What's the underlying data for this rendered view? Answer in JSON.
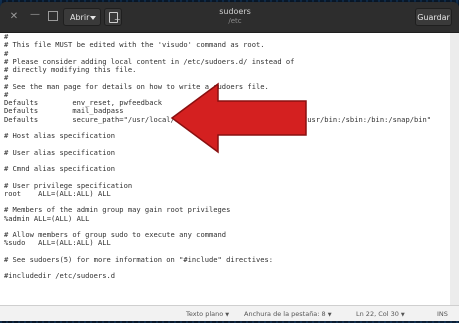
{
  "window": {
    "title": "sudoers",
    "subtitle": "/etc",
    "open_label": "Abrir",
    "save_label": "Guardar"
  },
  "editor": {
    "lines": [
      "#",
      "# This file MUST be edited with the 'visudo' command as root.",
      "#",
      "# Please consider adding local content in /etc/sudoers.d/ instead of",
      "# directly modifying this file.",
      "#",
      "# See the man page for details on how to write a sudoers file.",
      "#",
      "Defaults        env_reset, pwfeedback",
      "Defaults        mail_badpass",
      "Defaults        secure_path=\"/usr/local/sbin:/usr/local/bin:/usr/sbin:/usr/bin:/sbin:/bin:/snap/bin\"",
      "",
      "# Host alias specification",
      "",
      "# User alias specification",
      "",
      "# Cmnd alias specification",
      "",
      "# User privilege specification",
      "root    ALL=(ALL:ALL) ALL",
      "",
      "# Members of the admin group may gain root privileges",
      "%admin ALL=(ALL) ALL",
      "",
      "# Allow members of group sudo to execute any command",
      "%sudo   ALL=(ALL:ALL) ALL",
      "",
      "# See sudoers(5) for more information on \"#include\" directives:",
      "",
      "#includedir /etc/sudoers.d",
      "",
      ""
    ]
  },
  "statusbar": {
    "syntax": "Texto plano",
    "tab_width": "Anchura de la pestaña: 8",
    "position": "Ln 22, Col 30",
    "mode": "INS"
  },
  "annotation": {
    "arrow_color": "#d42020"
  }
}
